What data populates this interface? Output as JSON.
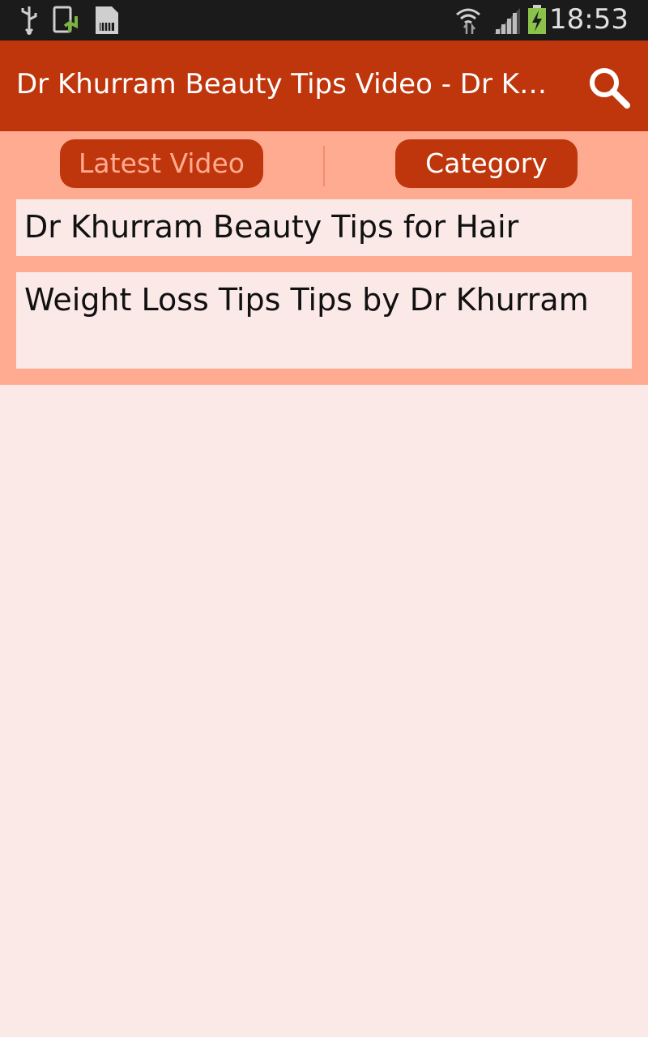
{
  "status_bar": {
    "time": "18:53",
    "icons": [
      "usb-icon",
      "screenshot-upload-icon",
      "sd-card-icon",
      "wifi-icon",
      "signal-icon",
      "battery-charging-icon"
    ]
  },
  "app_bar": {
    "title": "Dr Khurram Beauty Tips Video - Dr Khurram",
    "search_icon": "search-icon"
  },
  "tabs": [
    {
      "label": "Latest Video",
      "selected": true
    },
    {
      "label": "Category",
      "selected": false
    }
  ],
  "list": {
    "items": [
      {
        "label": "Dr Khurram Beauty Tips for Hair"
      },
      {
        "label": "Weight Loss Tips Tips by Dr Khurram"
      }
    ]
  },
  "colors": {
    "primary": "#bf360c",
    "accent_light": "#ffab91",
    "background": "#fbe9e7",
    "status_bar": "#1b1b1b"
  }
}
